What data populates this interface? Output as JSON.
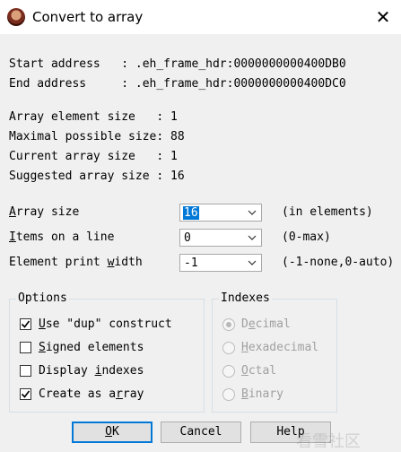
{
  "window": {
    "title": "Convert to array",
    "close_glyph": "✕"
  },
  "info": {
    "start_address_line": "Start address   : .eh_frame_hdr:0000000000400DB0",
    "end_address_line": "End address     : .eh_frame_hdr:0000000000400DC0",
    "element_size_line": "Array element size   : 1",
    "maximal_size_line": "Maximal possible size: 88",
    "current_size_line": "Current array size   : 1",
    "suggested_size_line": "Suggested array size : 16"
  },
  "fields": {
    "array_size": {
      "label_mn": "A",
      "label_rest": "rray size",
      "value": "16",
      "hint": "(in elements)"
    },
    "items_on_line": {
      "label_mn": "I",
      "label_rest": "tems on a line",
      "value": "0",
      "hint": "(0-max)"
    },
    "print_width": {
      "label_pre": "Element print ",
      "label_mn": "w",
      "label_rest": "idth",
      "value": "-1",
      "hint": "(-1-none,0-auto)"
    }
  },
  "options": {
    "title": "Options",
    "items": [
      {
        "pre": "",
        "mn": "U",
        "rest": "se \"dup\" construct",
        "checked": true
      },
      {
        "pre": "",
        "mn": "S",
        "rest": "igned elements",
        "checked": false
      },
      {
        "pre": "Display ",
        "mn": "i",
        "rest": "ndexes",
        "checked": false
      },
      {
        "pre": "Create as a",
        "mn": "r",
        "rest": "ray",
        "checked": true
      }
    ]
  },
  "indexes": {
    "title": "Indexes",
    "items": [
      {
        "pre": "D",
        "mn": "e",
        "rest": "cimal",
        "selected": true
      },
      {
        "pre": "",
        "mn": "H",
        "rest": "exadecimal",
        "selected": false
      },
      {
        "pre": "",
        "mn": "O",
        "rest": "ctal",
        "selected": false
      },
      {
        "pre": "",
        "mn": "B",
        "rest": "inary",
        "selected": false
      }
    ]
  },
  "buttons": {
    "ok": {
      "mn": "O",
      "rest": "K"
    },
    "cancel": "Cancel",
    "help": "Help"
  },
  "watermark": "看雪社区",
  "colors": {
    "accent": "#0078d7",
    "background": "#f0f0f0"
  }
}
